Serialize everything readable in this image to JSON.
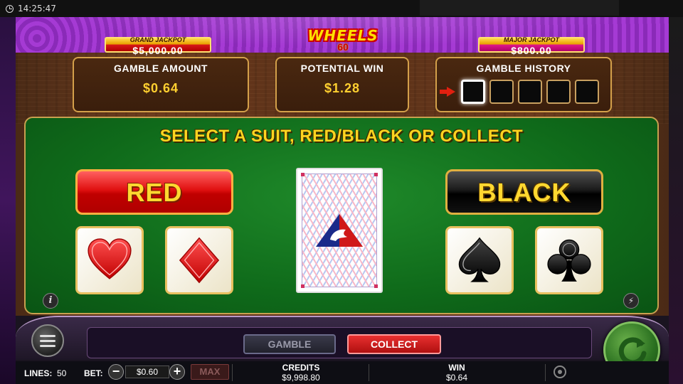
{
  "status_bar": {
    "time": "14:25:47"
  },
  "jackpots": {
    "grand": {
      "label": "GRAND JACKPOT",
      "value": "$5,000.00"
    },
    "major": {
      "label": "MAJOR JACKPOT",
      "value": "$800.00"
    }
  },
  "logo": {
    "title": "WHEELS",
    "sub": "60"
  },
  "gamble_amount": {
    "title": "GAMBLE AMOUNT",
    "value": "$0.64"
  },
  "potential_win": {
    "title": "POTENTIAL WIN",
    "value": "$1.28"
  },
  "gamble_history": {
    "title": "GAMBLE HISTORY",
    "slots": 5,
    "active_slot": 1
  },
  "table": {
    "prompt": "SELECT A SUIT, RED/BLACK OR COLLECT",
    "red_label": "RED",
    "black_label": "BLACK",
    "suits": [
      "heart",
      "diamond",
      "spade",
      "club"
    ]
  },
  "controls": {
    "gamble_label": "GAMBLE",
    "collect_label": "COLLECT",
    "lines_label": "LINES:",
    "lines_value": "50",
    "bet_label": "BET:",
    "bet_value": "$0.60",
    "max_label": "MAX",
    "credits_label": "CREDITS",
    "credits_value": "$9,998.80",
    "win_label": "WIN",
    "win_value": "$0.64"
  },
  "icons": {
    "clock": "clock-icon",
    "arrow": "arrow-icon",
    "info": "info-icon",
    "turbo": "lightning-icon",
    "menu": "menu-icon",
    "spin": "spin-icon",
    "settings": "settings-icon"
  },
  "colors": {
    "accent_gold": "#ffd520",
    "table_green": "#1f8a2a",
    "red_button": "#e01010",
    "black_button": "#1a1a1a",
    "collect_button": "#d02020"
  }
}
